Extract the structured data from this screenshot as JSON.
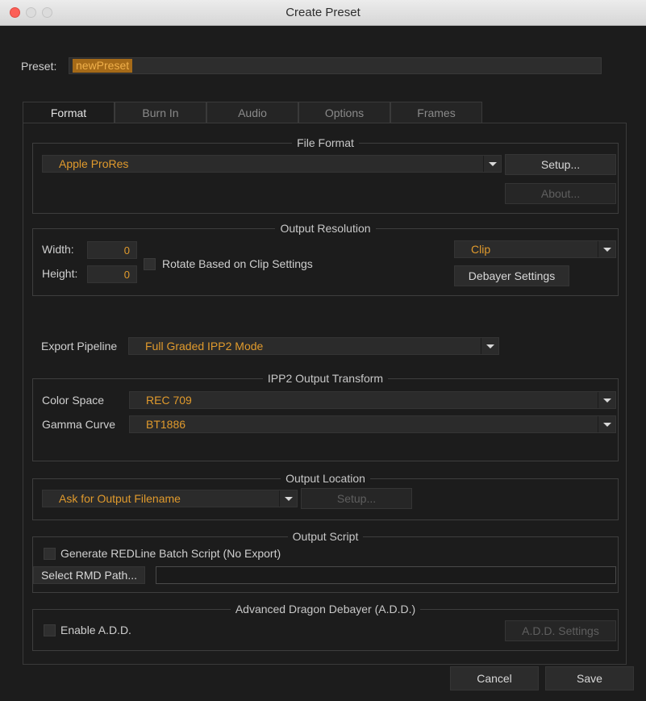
{
  "window": {
    "title": "Create Preset"
  },
  "preset": {
    "label": "Preset:",
    "value": "newPreset"
  },
  "tabs": [
    {
      "label": "Format",
      "active": true
    },
    {
      "label": "Burn In",
      "active": false
    },
    {
      "label": "Audio",
      "active": false
    },
    {
      "label": "Options",
      "active": false
    },
    {
      "label": "Frames",
      "active": false
    }
  ],
  "file_format": {
    "title": "File Format",
    "format_value": "Apple ProRes",
    "setup_button": "Setup...",
    "about_button": "About..."
  },
  "output_resolution": {
    "title": "Output Resolution",
    "width_label": "Width:",
    "width_value": "0",
    "height_label": "Height:",
    "height_value": "0",
    "rotate_label": "Rotate Based on Clip Settings",
    "rotate_checked": false,
    "source_value": "Clip",
    "debayer_button": "Debayer Settings"
  },
  "export_pipeline": {
    "label": "Export Pipeline",
    "value": "Full Graded IPP2 Mode"
  },
  "ipp2": {
    "title": "IPP2 Output Transform",
    "color_space_label": "Color Space",
    "color_space_value": "REC 709",
    "gamma_label": "Gamma Curve",
    "gamma_value": "BT1886"
  },
  "output_location": {
    "title": "Output Location",
    "value": "Ask for Output Filename",
    "setup_button": "Setup..."
  },
  "output_script": {
    "title": "Output Script",
    "generate_label": "Generate REDLine Batch Script (No Export)",
    "generate_checked": false,
    "select_rmd_button": "Select RMD Path...",
    "rmd_path_value": ""
  },
  "add": {
    "title": "Advanced Dragon Debayer (A.D.D.)",
    "enable_label": "Enable A.D.D.",
    "enable_checked": false,
    "settings_button": "A.D.D. Settings"
  },
  "footer": {
    "cancel_button": "Cancel",
    "save_button": "Save"
  },
  "colors": {
    "accent": "#e09a2c",
    "background": "#1c1c1c",
    "close_button": "#fc5f57"
  }
}
